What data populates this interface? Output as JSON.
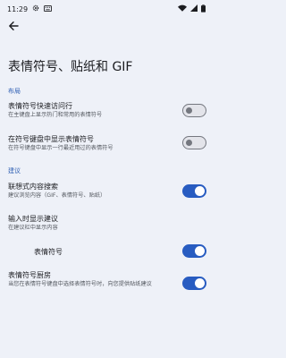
{
  "status": {
    "time": "11:29"
  },
  "page": {
    "title": "表情符号、贴纸和 GIF"
  },
  "sections": {
    "layout": {
      "header": "布局"
    },
    "suggestions": {
      "header": "建议"
    }
  },
  "prefs": {
    "quick_access": {
      "title": "表情符号快速访问行",
      "summary": "在主键盘上显示热门和常用的表情符号",
      "enabled": false
    },
    "symbol_keyboard": {
      "title": "在符号键盘中显示表情符号",
      "summary": "在符号键盘中显示一行最近用过的表情符号",
      "enabled": false
    },
    "associative": {
      "title": "联想式内容搜索",
      "summary": "建议浏览内容（GIF、表情符号、贴纸）",
      "enabled": true
    },
    "typing_suggestions": {
      "title": "输入时显示建议",
      "summary": "在建议栏中显示内容"
    },
    "emoji": {
      "title": "表情符号",
      "enabled": true
    },
    "emoji_kitchen": {
      "title": "表情符号厨房",
      "summary": "当您在表情符号键盘中选择表情符号时，向您提供贴纸建议",
      "enabled": true
    }
  }
}
